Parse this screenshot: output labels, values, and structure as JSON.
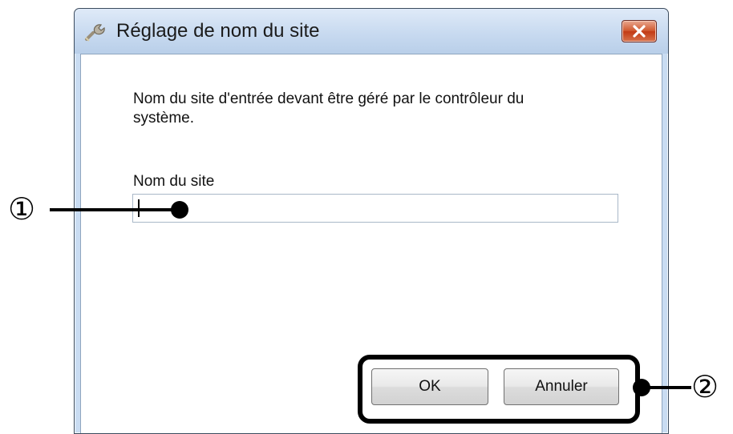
{
  "window": {
    "title": "Réglage de nom du site",
    "close_icon": "close-icon",
    "title_icon": "wrench-icon"
  },
  "dialog": {
    "description": "Nom du site d'entrée devant être géré par le contrôleur du système.",
    "field_label": "Nom du site",
    "site_name_value": "",
    "ok_label": "OK",
    "cancel_label": "Annuler"
  },
  "callouts": {
    "one": "①",
    "two": "②"
  },
  "colors": {
    "titlebar": "#c8daf0",
    "close_button": "#c23a14",
    "callout": "#000000"
  }
}
